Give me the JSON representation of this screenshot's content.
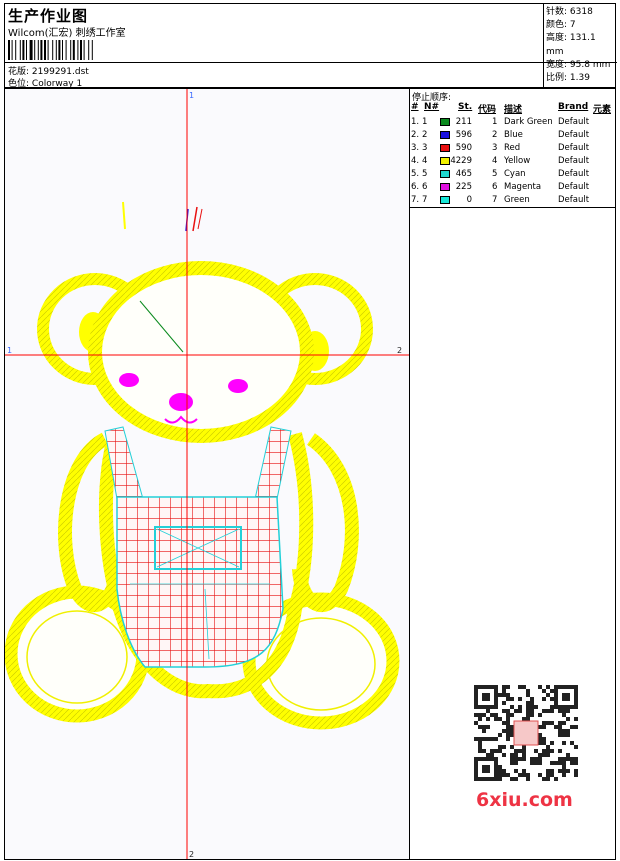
{
  "header": {
    "title": "生产作业图",
    "studio": "Wilcom(汇宏) 刺绣工作室",
    "design_label": "花版:",
    "design_file": "2199291.dst",
    "colorway_label": "色位:",
    "colorway_name": "Colorway 1"
  },
  "stats": [
    {
      "label": "针数:",
      "value": "6318"
    },
    {
      "label": "颜色:",
      "value": "7"
    },
    {
      "label": "高度:",
      "value": "131.1 mm"
    },
    {
      "label": "宽度:",
      "value": "95.8 mm"
    },
    {
      "label": "比例:",
      "value": "1.39"
    }
  ],
  "axes": {
    "top": "1",
    "left": "1",
    "right": "2",
    "bottom": "2"
  },
  "stop_sequence": {
    "title": "停止顺序:",
    "columns": [
      "#",
      "N#",
      "St.",
      "代码",
      "描述",
      "Brand",
      "元素"
    ],
    "rows": [
      {
        "num": "1.",
        "n": "1",
        "color": "#0a8a1e",
        "st": "211",
        "code": "1",
        "desc": "Dark Green",
        "brand": "Default"
      },
      {
        "num": "2.",
        "n": "2",
        "color": "#1a10e0",
        "st": "596",
        "code": "2",
        "desc": "Blue",
        "brand": "Default"
      },
      {
        "num": "3.",
        "n": "3",
        "color": "#e81010",
        "st": "590",
        "code": "3",
        "desc": "Red",
        "brand": "Default"
      },
      {
        "num": "4.",
        "n": "4",
        "color": "#f2f200",
        "st": "4229",
        "code": "4",
        "desc": "Yellow",
        "brand": "Default"
      },
      {
        "num": "5.",
        "n": "5",
        "color": "#20d8d0",
        "st": "465",
        "code": "5",
        "desc": "Cyan",
        "brand": "Default"
      },
      {
        "num": "6.",
        "n": "6",
        "color": "#e010e0",
        "st": "225",
        "code": "6",
        "desc": "Magenta",
        "brand": "Default"
      },
      {
        "num": "7.",
        "n": "7",
        "color": "#18e8d8",
        "st": "0",
        "code": "7",
        "desc": "Green",
        "brand": "Default"
      }
    ]
  },
  "watermark": {
    "site": "6xiu.com"
  },
  "colors": {
    "yellow": "#ffff00",
    "red": "#ff0000",
    "cyan": "#22d0d8",
    "magenta": "#ff00ff",
    "axis": "#ff0000"
  }
}
